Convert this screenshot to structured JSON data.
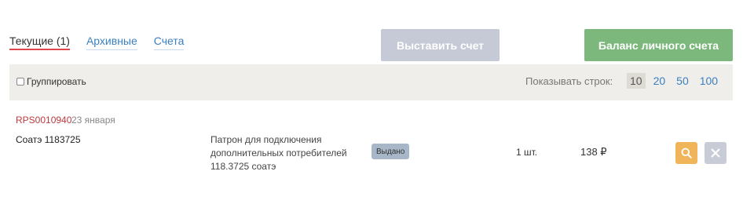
{
  "tabs": [
    {
      "label": "Текущие (1)",
      "active": true
    },
    {
      "label": "Архивные",
      "active": false
    },
    {
      "label": "Счета",
      "active": false
    }
  ],
  "actions": {
    "invoice_label": "Выставить счет",
    "balance_label": "Баланс личного счета"
  },
  "toolbar": {
    "group_label": "Группировать",
    "group_checked": false,
    "rows_label": "Показывать строк:",
    "rows_options": [
      "10",
      "20",
      "50",
      "100"
    ],
    "rows_selected": "10"
  },
  "order": {
    "id": "RPS0010940",
    "date": "23 января",
    "account": "Соатэ 1183725",
    "description_lines": [
      "Патрон для подключения",
      "дополнительных потребителей",
      "118.3725 соатэ"
    ],
    "status": "Выдано",
    "quantity": "1 шт.",
    "price": "138 ₽"
  },
  "icons": {
    "search": "magnifier-icon",
    "delete": "close-icon"
  },
  "colors": {
    "accent_red": "#e0474c",
    "link_blue": "#3a7fbf",
    "balance_green": "#7cb87c",
    "search_orange": "#f0b45a"
  }
}
